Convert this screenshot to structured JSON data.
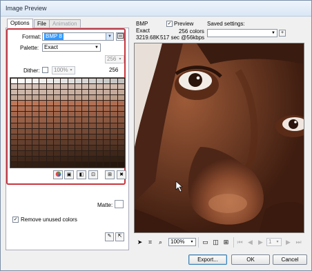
{
  "window": {
    "title": "Image Preview"
  },
  "tabs": [
    {
      "label": "Options",
      "state": "active"
    },
    {
      "label": "File",
      "state": "normal"
    },
    {
      "label": "Animation",
      "state": "disabled"
    }
  ],
  "options": {
    "format_label": "Format:",
    "format_value": "BMP 8",
    "palette_label": "Palette:",
    "palette_value": "Exact",
    "colors_value": "256",
    "colors_count": "256",
    "dither_label": "Dither:",
    "dither_value": "100%",
    "matte_label": "Matte:",
    "remove_unused_label": "Remove unused colors",
    "check_mark": "✓"
  },
  "info": {
    "format": "BMP",
    "palette": "Exact",
    "size": "3219.68K",
    "time": "517 sec @56kbps",
    "preview_label": "Preview",
    "colors": "256 colors"
  },
  "saved_settings": {
    "label": "Saved settings:",
    "value": ""
  },
  "zoom": {
    "value": "100%"
  },
  "frame": {
    "value": "1"
  },
  "buttons": {
    "export": "Export...",
    "ok": "OK",
    "cancel": "Cancel"
  },
  "colors": {
    "accent": "#3399ff",
    "highlight_box": "#c8343d",
    "skin_dark": "#5a2f1b",
    "skin_mid": "#8b4a2b",
    "skin_light": "#b87a52"
  },
  "icons": {
    "format_options": "settings-icon",
    "saved_add": "plus-icon",
    "pointer": "pointer-icon",
    "crop": "crop-icon",
    "zoom": "magnifier-icon"
  }
}
